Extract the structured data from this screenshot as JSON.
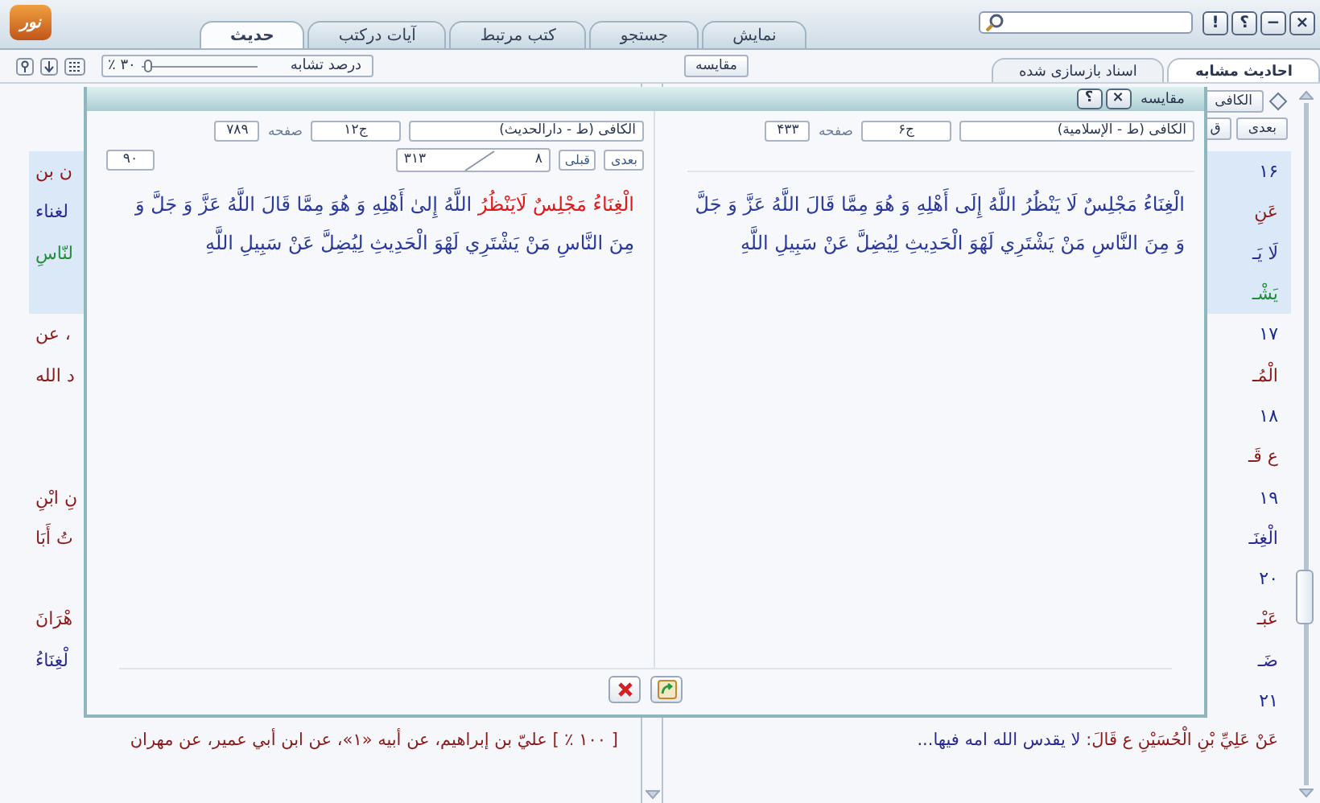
{
  "app": {
    "logo": "نور",
    "tabs": [
      {
        "label": "نمایش",
        "selected": false
      },
      {
        "label": "جستجو",
        "selected": false
      },
      {
        "label": "کتب مرتبط",
        "selected": false
      },
      {
        "label": "آیات درکتب",
        "selected": false
      },
      {
        "label": "حدیث",
        "selected": true
      }
    ],
    "window_buttons": [
      "×",
      "−",
      "؟",
      "!"
    ]
  },
  "toolbar": {
    "similarity": {
      "label": "درصد تشابه",
      "value": "۳۰",
      "unit": "٪",
      "level": 0.05
    },
    "compare_button": "مقایسه",
    "result_tabs": [
      {
        "label": "احادیث مشابه",
        "selected": true
      },
      {
        "label": "اسناد بازسازی شده",
        "selected": false
      }
    ]
  },
  "right_panel_header": {
    "book_button": "الکافی",
    "next_button": "بعدی",
    "prev_button": "ق"
  },
  "rows": [
    {
      "selected": true,
      "left": {
        "text": "ن بن",
        "kind": "sanad"
      },
      "right": {
        "text": "۱۶",
        "kind": "number"
      }
    },
    {
      "selected": true,
      "left": {
        "text": "لغناء",
        "kind": "matn"
      },
      "right": {
        "text": "عَنِ",
        "kind": "sanad"
      }
    },
    {
      "selected": true,
      "left": {
        "text": "لنّاسِ",
        "kind": "quran"
      },
      "right": {
        "text": "لَا يَـ",
        "kind": "matn"
      }
    },
    {
      "selected": true,
      "right": {
        "text": "يَشْـ",
        "kind": "quran"
      }
    },
    {
      "selected": false,
      "left": {
        "text": "، عن",
        "kind": "sanad"
      },
      "right": {
        "text": "۱۷",
        "kind": "number"
      }
    },
    {
      "selected": false,
      "left": {
        "text": "د الله",
        "kind": "sanad"
      },
      "right": {
        "text": "الْمُـ",
        "kind": "sanad"
      }
    },
    {
      "selected": false,
      "right": {
        "text": "۱۸",
        "kind": "number"
      }
    },
    {
      "selected": false,
      "right": {
        "text": "ع قَـ",
        "kind": "sanad"
      }
    },
    {
      "selected": false,
      "left": {
        "text": "نِ ابْنِ",
        "kind": "sanad"
      },
      "right": {
        "text": "۱۹",
        "kind": "number"
      }
    },
    {
      "selected": false,
      "left": {
        "text": "تُ أَبَا",
        "kind": "sanad"
      },
      "right": {
        "text": "الْغِنَـ",
        "kind": "matn"
      }
    },
    {
      "selected": false,
      "right": {
        "text": "۲۰",
        "kind": "number"
      }
    },
    {
      "selected": false,
      "left": {
        "text": "هْرَانَ",
        "kind": "sanad"
      },
      "right": {
        "text": "عَبْـ",
        "kind": "sanad"
      }
    },
    {
      "selected": false,
      "left": {
        "text": "لْغِنَاءُ",
        "kind": "matn"
      },
      "right": {
        "text": "ضَـ",
        "kind": "matn"
      }
    },
    {
      "selected": false,
      "right": {
        "text": "۲۱",
        "kind": "number"
      }
    }
  ],
  "bottom_row": {
    "left": "[ ۱۰۰ ٪ ] عليّ بن إبراهيم، عن أبيه «۱»، عن ابن أبي عمير، عن مهران",
    "right_parts": [
      {
        "text": "عَنْ عَلِيِّ بْنِ الْحُسَيْنِ ع قَالَ: ",
        "kind": "sanad"
      },
      {
        "text": "لا يقدس الله امه فيها...",
        "kind": "matn"
      }
    ]
  },
  "dialog": {
    "title": "مقایسه",
    "buttons": [
      "×",
      "؟"
    ],
    "panes": [
      {
        "book": "الکافی (ط - الإسلامیة)",
        "volume": "ج۶",
        "page_label": "صفحه",
        "page": "۴۳۳",
        "text_parts": [
          {
            "text": "الْغِنَاءُ مَجْلِسٌ لَا يَنْظُرُ اللَّهُ إِلَى أَهْلِهِ وَ هُوَ مِمَّا قَالَ اللَّهُ عَزَّ وَ جَلَّ وَ مِنَ النَّاسِ مَنْ يَشْتَرِي لَهْوَ الْحَدِيثِ لِيُضِلَّ عَنْ سَبِيلِ اللَّهِ",
            "highlighted": false
          }
        ]
      },
      {
        "book": "الکافی (ط - دارالحدیث)",
        "volume": "ج۱۲",
        "page_label": "صفحه",
        "page": "۷۸۹",
        "nav": {
          "next": "بعدی",
          "prev": "قبلی",
          "counter_first": "۳۱۳",
          "counter_second": "۸",
          "count": "۹۰"
        },
        "text_parts": [
          {
            "text": "الْغِنَاءُ مَجْلِسٌ لَايَنْظُرُ ",
            "highlighted": true
          },
          {
            "text": "اللَّهُ إِلىٰ أَهْلِهِ وَ هُوَ مِمَّا قَالَ اللَّهُ عَزَّ وَ جَلَّ وَ مِنَ النَّاسِ مَنْ يَشْتَرِي لَهْوَ الْحَدِيثِ لِيُضِلَّ عَنْ سَبِيلِ اللَّهِ",
            "highlighted": false
          }
        ]
      }
    ]
  }
}
